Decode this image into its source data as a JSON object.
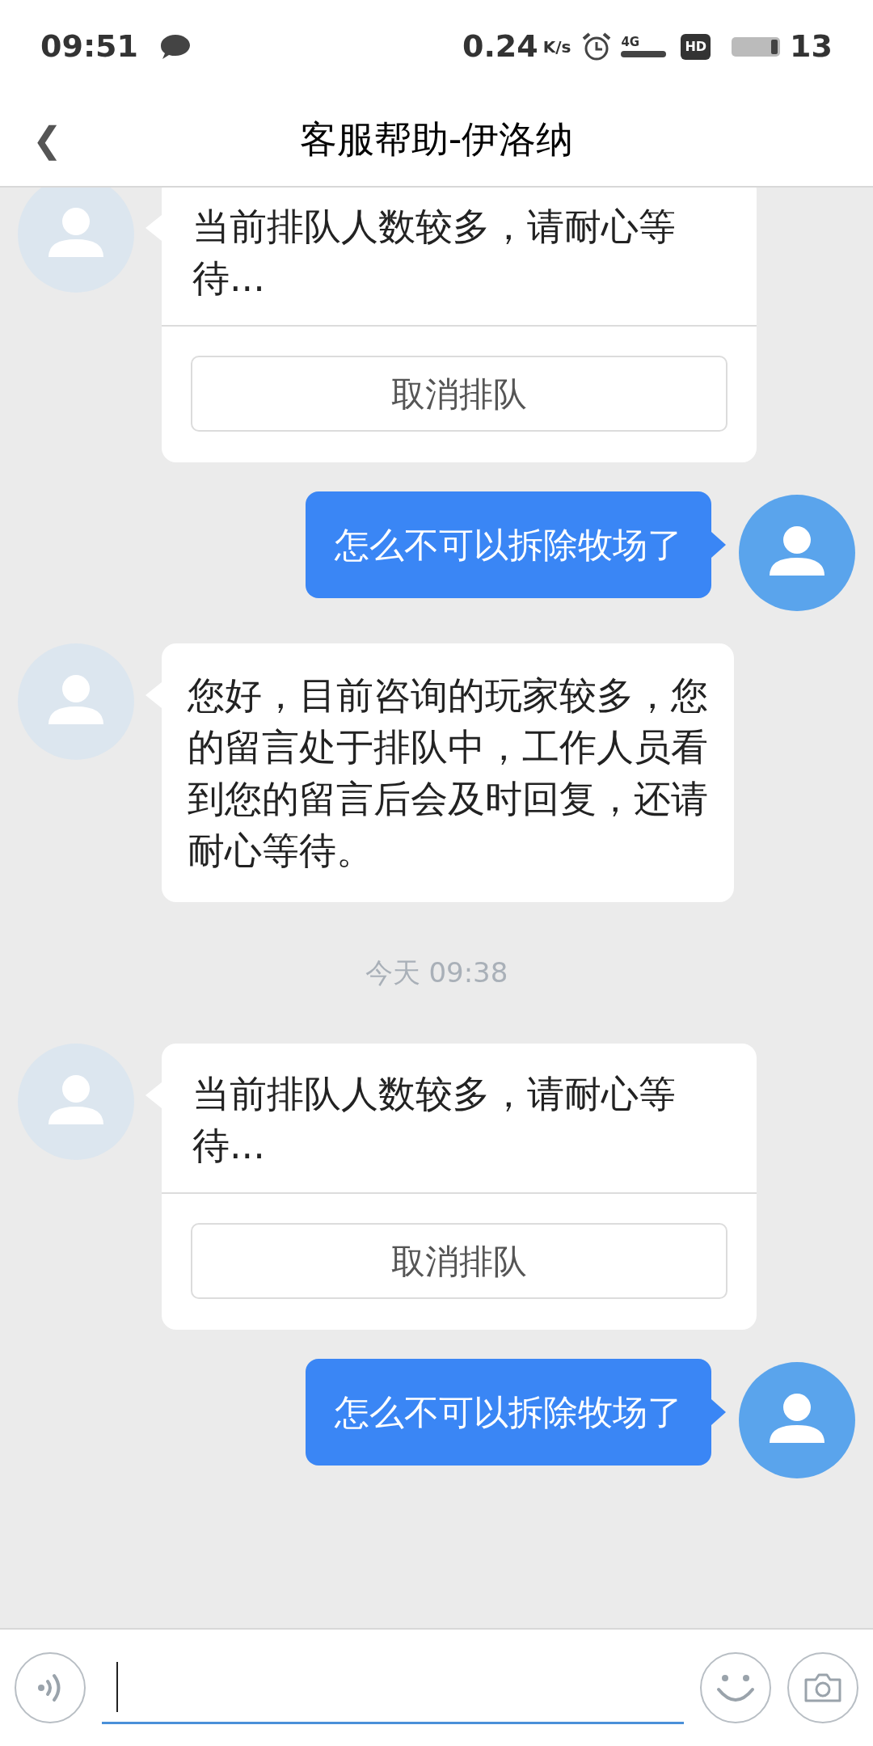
{
  "status_bar": {
    "time": "09:51",
    "speed": "0.24",
    "speed_unit": "K/s",
    "network": "4G",
    "hd": "HD",
    "battery": "13"
  },
  "header": {
    "back": "❮",
    "title": "客服帮助-伊洛纳"
  },
  "messages": [
    {
      "kind": "queue",
      "text": "当前排队人数较多，请耐心等待...",
      "button": "取消排队"
    },
    {
      "kind": "user",
      "text": "怎么不可以拆除牧场了"
    },
    {
      "kind": "agent",
      "text": "您好，目前咨询的玩家较多，您的留言处于排队中，工作人员看到您的留言后会及时回复，还请耐心等待。"
    },
    {
      "kind": "time",
      "text": "今天 09:38"
    },
    {
      "kind": "queue",
      "text": "当前排队人数较多，请耐心等待...",
      "button": "取消排队"
    },
    {
      "kind": "user",
      "text": "怎么不可以拆除牧场了"
    }
  ]
}
